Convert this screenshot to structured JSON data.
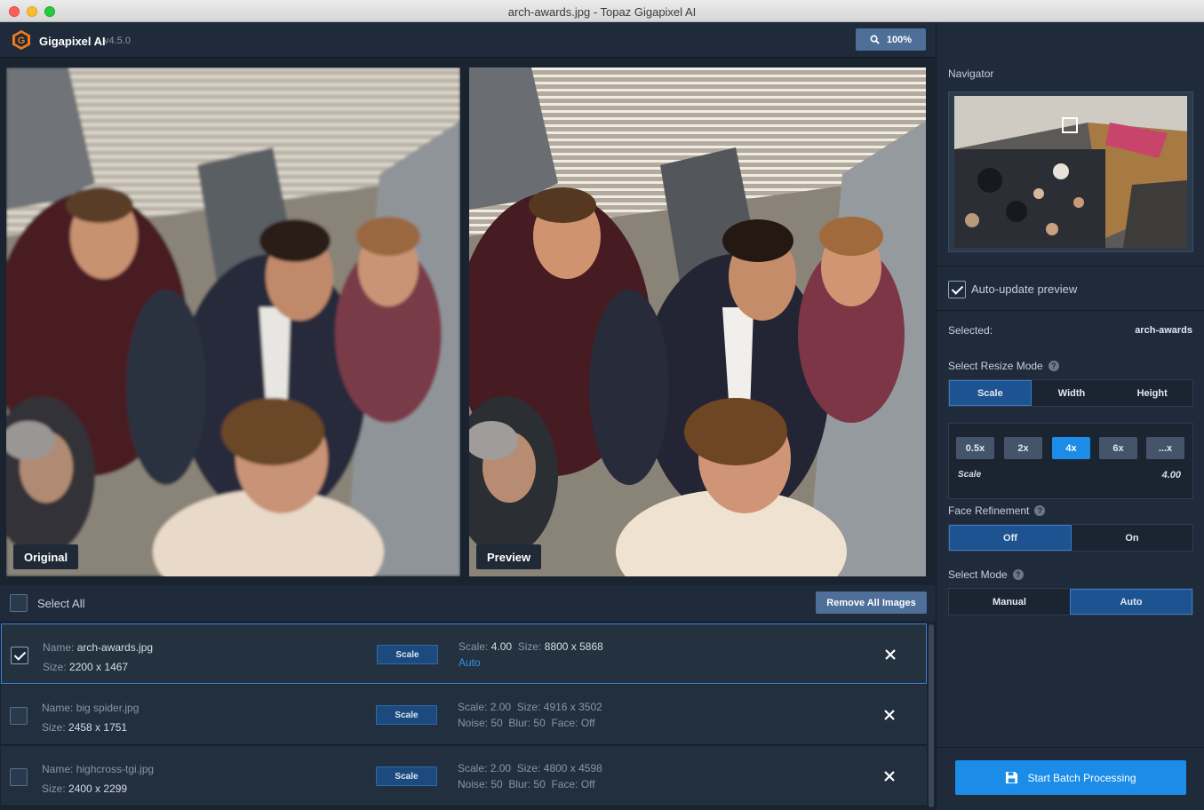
{
  "window": {
    "title": "arch-awards.jpg - Topaz Gigapixel AI"
  },
  "app": {
    "name": "Gigapixel AI",
    "version": "v4.5.0",
    "zoom": "100%"
  },
  "viewer": {
    "original_label": "Original",
    "preview_label": "Preview"
  },
  "list": {
    "select_all": "Select All",
    "remove_all": "Remove All Images",
    "items": [
      {
        "name": "arch-awards.jpg",
        "size": "2200 x 1467",
        "scale_btn": "Scale",
        "scale": "4.00",
        "out_size": "8800 x 5868",
        "mode": "Auto",
        "checked": true
      },
      {
        "name": "big spider.jpg",
        "size": "2458 x 1751",
        "scale_btn": "Scale",
        "scale": "2.00",
        "out_size": "4916 x 3502",
        "noise": "50",
        "blur": "50",
        "face": "Off",
        "checked": false
      },
      {
        "name": "highcross-tgi.jpg",
        "size": "2400 x 2299",
        "scale_btn": "Scale",
        "scale": "2.00",
        "out_size": "4800 x 4598",
        "noise": "50",
        "blur": "50",
        "face": "Off",
        "checked": false
      }
    ],
    "labels": {
      "name": "Name:",
      "size": "Size:",
      "scale": "Scale:",
      "noise": "Noise:",
      "blur": "Blur:",
      "face": "Face:"
    }
  },
  "side": {
    "navigator": "Navigator",
    "auto_update": "Auto-update preview",
    "selected_label": "Selected:",
    "selected_value": "arch-awards",
    "resize_mode_title": "Select Resize Mode",
    "resize_modes": [
      "Scale",
      "Width",
      "Height"
    ],
    "scale_options": [
      "0.5x",
      "2x",
      "4x",
      "6x",
      "...x"
    ],
    "scale_label": "Scale",
    "scale_value": "4.00",
    "face_title": "Face Refinement",
    "face_options": [
      "Off",
      "On"
    ],
    "mode_title": "Select Mode",
    "mode_options": [
      "Manual",
      "Auto"
    ],
    "start": "Start Batch Processing"
  },
  "colors": {
    "accent": "#1b8de8",
    "selected": "#1d5391",
    "logo": "#f07a1a"
  }
}
